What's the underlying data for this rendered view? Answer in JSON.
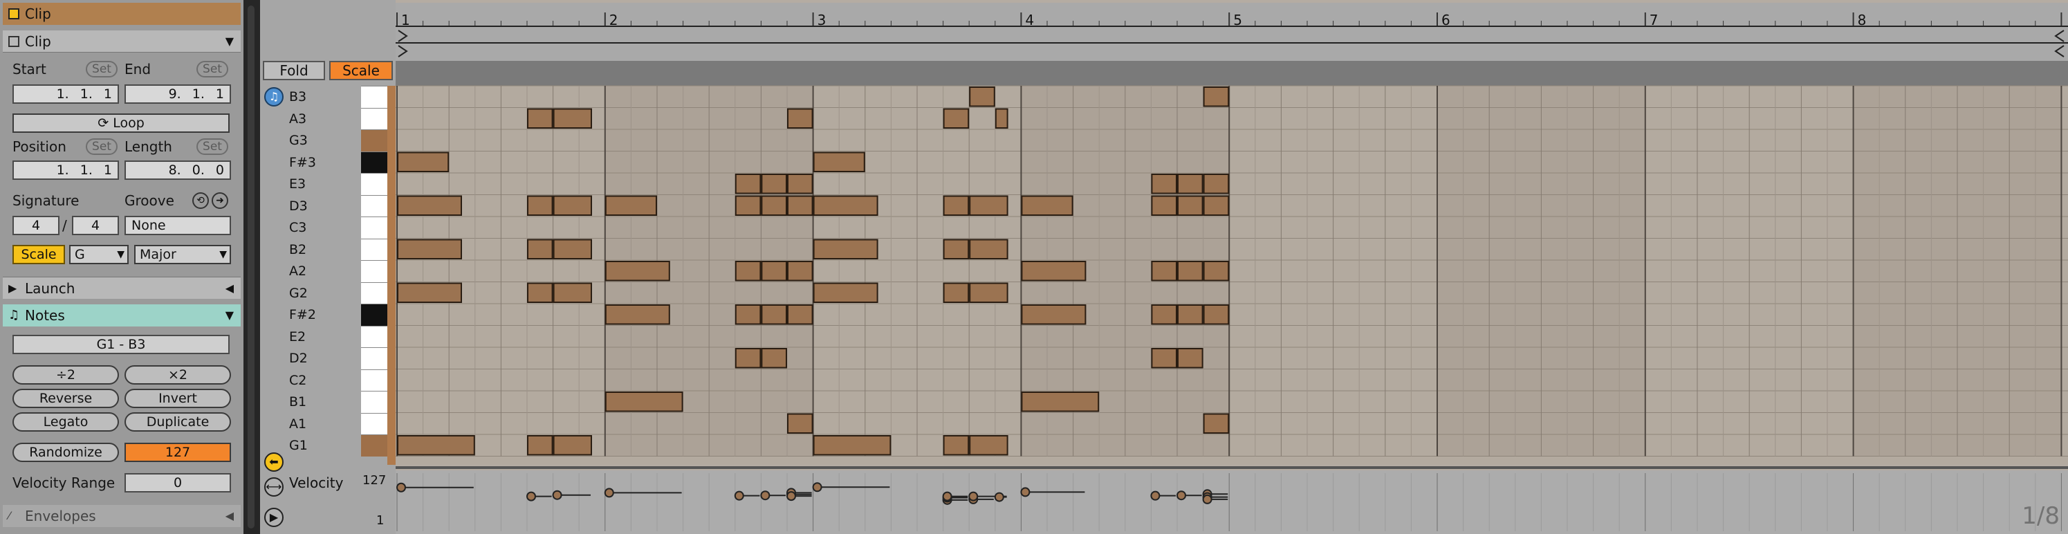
{
  "clip_panel": {
    "top_title": "Clip",
    "section_title": "Clip",
    "start_label": "Start",
    "end_label": "End",
    "set_label": "Set",
    "start_value": "1.  1.  1",
    "end_value": "9.  1.  1",
    "loop_label": "Loop",
    "position_label": "Position",
    "length_label": "Length",
    "position_value": "1.  1.  1",
    "length_value": "8.  0.  0",
    "signature_label": "Signature",
    "groove_label": "Groove",
    "sig_num": "4",
    "sig_den": "4",
    "groove_value": "None",
    "scale_label": "Scale",
    "scale_root": "G",
    "scale_mode": "Major"
  },
  "launch_section": {
    "title": "Launch"
  },
  "notes_section": {
    "title": "Notes",
    "range": "G1 - B3",
    "half_label": "÷2",
    "double_label": "×2",
    "reverse_label": "Reverse",
    "invert_label": "Invert",
    "legato_label": "Legato",
    "duplicate_label": "Duplicate",
    "randomize_label": "Randomize",
    "randomize_value": "127",
    "velocity_range_label": "Velocity Range",
    "velocity_range_value": "0"
  },
  "envelopes_section": {
    "title": "Envelopes"
  },
  "editor": {
    "fold_label": "Fold",
    "scale_label": "Scale",
    "rows": [
      "B3",
      "A3",
      "G3",
      "F#3",
      "E3",
      "D3",
      "C3",
      "B2",
      "A2",
      "G2",
      "F#2",
      "E2",
      "D2",
      "C2",
      "B1",
      "A1",
      "G1"
    ],
    "key_colors": [
      "white",
      "white",
      "brown",
      "black",
      "white",
      "white",
      "white",
      "white",
      "white",
      "white",
      "black",
      "white",
      "white",
      "white",
      "white",
      "white",
      "brown"
    ],
    "bar_numbers": [
      "1",
      "2",
      "3",
      "4",
      "5",
      "6",
      "7",
      "8"
    ],
    "velocity_label": "Velocity",
    "velocity_max": "127",
    "velocity_min": "1",
    "zoom_label": "1/8",
    "colors": {
      "note_fill": "#9b7351",
      "note_border": "#2a1d12",
      "accent_orange": "#f3852b",
      "accent_yellow": "#f6c21a",
      "notes_header": "#9cd3c8"
    }
  },
  "notes": [
    {
      "pitch": "F#3",
      "start": 0,
      "dur": 2
    },
    {
      "pitch": "D3",
      "start": 0,
      "dur": 2.5
    },
    {
      "pitch": "B2",
      "start": 0,
      "dur": 2.5
    },
    {
      "pitch": "G2",
      "start": 0,
      "dur": 2.5
    },
    {
      "pitch": "G1",
      "start": 0,
      "dur": 3
    },
    {
      "pitch": "A3",
      "start": 5,
      "dur": 1
    },
    {
      "pitch": "A3",
      "start": 6,
      "dur": 1.5
    },
    {
      "pitch": "D3",
      "start": 5,
      "dur": 1
    },
    {
      "pitch": "D3",
      "start": 6,
      "dur": 1.5
    },
    {
      "pitch": "B2",
      "start": 5,
      "dur": 1
    },
    {
      "pitch": "B2",
      "start": 6,
      "dur": 1.5
    },
    {
      "pitch": "G2",
      "start": 5,
      "dur": 1
    },
    {
      "pitch": "G2",
      "start": 6,
      "dur": 1.5
    },
    {
      "pitch": "G1",
      "start": 5,
      "dur": 1
    },
    {
      "pitch": "G1",
      "start": 6,
      "dur": 1.5
    },
    {
      "pitch": "D3",
      "start": 8,
      "dur": 2
    },
    {
      "pitch": "A2",
      "start": 8,
      "dur": 2.5
    },
    {
      "pitch": "F#2",
      "start": 8,
      "dur": 2.5
    },
    {
      "pitch": "B1",
      "start": 8,
      "dur": 3
    },
    {
      "pitch": "E3",
      "start": 13,
      "dur": 1
    },
    {
      "pitch": "E3",
      "start": 14,
      "dur": 1
    },
    {
      "pitch": "E3",
      "start": 15,
      "dur": 1
    },
    {
      "pitch": "D3",
      "start": 13,
      "dur": 1
    },
    {
      "pitch": "D3",
      "start": 14,
      "dur": 1
    },
    {
      "pitch": "D3",
      "start": 15,
      "dur": 1
    },
    {
      "pitch": "A2",
      "start": 13,
      "dur": 1
    },
    {
      "pitch": "A2",
      "start": 14,
      "dur": 1
    },
    {
      "pitch": "A2",
      "start": 15,
      "dur": 1
    },
    {
      "pitch": "F#2",
      "start": 13,
      "dur": 1
    },
    {
      "pitch": "F#2",
      "start": 14,
      "dur": 1
    },
    {
      "pitch": "F#2",
      "start": 15,
      "dur": 1
    },
    {
      "pitch": "D2",
      "start": 13,
      "dur": 1
    },
    {
      "pitch": "D2",
      "start": 14,
      "dur": 1
    },
    {
      "pitch": "A3",
      "start": 15,
      "dur": 1
    },
    {
      "pitch": "A1",
      "start": 15,
      "dur": 1
    },
    {
      "pitch": "F#3",
      "start": 16,
      "dur": 2
    },
    {
      "pitch": "D3",
      "start": 16,
      "dur": 2.5
    },
    {
      "pitch": "B2",
      "start": 16,
      "dur": 2.5
    },
    {
      "pitch": "G2",
      "start": 16,
      "dur": 2.5
    },
    {
      "pitch": "G1",
      "start": 16,
      "dur": 3
    },
    {
      "pitch": "B3",
      "start": 22,
      "dur": 1
    },
    {
      "pitch": "A3",
      "start": 21,
      "dur": 1
    },
    {
      "pitch": "A3",
      "start": 23,
      "dur": 0.5
    },
    {
      "pitch": "D3",
      "start": 21,
      "dur": 1
    },
    {
      "pitch": "D3",
      "start": 22,
      "dur": 1.5
    },
    {
      "pitch": "B2",
      "start": 21,
      "dur": 1
    },
    {
      "pitch": "B2",
      "start": 22,
      "dur": 1.5
    },
    {
      "pitch": "G2",
      "start": 21,
      "dur": 1
    },
    {
      "pitch": "G2",
      "start": 22,
      "dur": 1.5
    },
    {
      "pitch": "G1",
      "start": 21,
      "dur": 1
    },
    {
      "pitch": "G1",
      "start": 22,
      "dur": 1.5
    },
    {
      "pitch": "D3",
      "start": 24,
      "dur": 2
    },
    {
      "pitch": "A2",
      "start": 24,
      "dur": 2.5
    },
    {
      "pitch": "F#2",
      "start": 24,
      "dur": 2.5
    },
    {
      "pitch": "B1",
      "start": 24,
      "dur": 3
    },
    {
      "pitch": "E3",
      "start": 29,
      "dur": 1
    },
    {
      "pitch": "E3",
      "start": 30,
      "dur": 1
    },
    {
      "pitch": "E3",
      "start": 31,
      "dur": 1
    },
    {
      "pitch": "D3",
      "start": 29,
      "dur": 1
    },
    {
      "pitch": "D3",
      "start": 30,
      "dur": 1
    },
    {
      "pitch": "D3",
      "start": 31,
      "dur": 1
    },
    {
      "pitch": "A2",
      "start": 29,
      "dur": 1
    },
    {
      "pitch": "A2",
      "start": 30,
      "dur": 1
    },
    {
      "pitch": "A2",
      "start": 31,
      "dur": 1
    },
    {
      "pitch": "F#2",
      "start": 29,
      "dur": 1
    },
    {
      "pitch": "F#2",
      "start": 30,
      "dur": 1
    },
    {
      "pitch": "F#2",
      "start": 31,
      "dur": 1
    },
    {
      "pitch": "D2",
      "start": 29,
      "dur": 1
    },
    {
      "pitch": "D2",
      "start": 30,
      "dur": 1
    },
    {
      "pitch": "B3",
      "start": 31,
      "dur": 1
    },
    {
      "pitch": "A1",
      "start": 31,
      "dur": 1
    }
  ],
  "velocities": [
    {
      "start": 0,
      "dur": 3,
      "vel": 117
    },
    {
      "start": 5,
      "dur": 1,
      "vel": 90
    },
    {
      "start": 6,
      "dur": 1.5,
      "vel": 94
    },
    {
      "start": 8,
      "dur": 3,
      "vel": 101
    },
    {
      "start": 13,
      "dur": 1,
      "vel": 92
    },
    {
      "start": 14,
      "dur": 1,
      "vel": 93
    },
    {
      "start": 15,
      "dur": 1,
      "vel": 96
    },
    {
      "start": 15,
      "dur": 1,
      "vel": 101
    },
    {
      "start": 15,
      "dur": 1,
      "vel": 91
    },
    {
      "start": 16,
      "dur": 3,
      "vel": 118
    },
    {
      "start": 21,
      "dur": 1,
      "vel": 79
    },
    {
      "start": 21,
      "dur": 1,
      "vel": 86
    },
    {
      "start": 21,
      "dur": 1,
      "vel": 90
    },
    {
      "start": 22,
      "dur": 1,
      "vel": 81
    },
    {
      "start": 22,
      "dur": 1.5,
      "vel": 90
    },
    {
      "start": 23,
      "dur": 0.5,
      "vel": 88
    },
    {
      "start": 24,
      "dur": 2.5,
      "vel": 103
    },
    {
      "start": 29,
      "dur": 1,
      "vel": 92
    },
    {
      "start": 30,
      "dur": 1,
      "vel": 93
    },
    {
      "start": 31,
      "dur": 1,
      "vel": 97
    },
    {
      "start": 31,
      "dur": 1,
      "vel": 88
    },
    {
      "start": 31,
      "dur": 1,
      "vel": 81
    }
  ]
}
